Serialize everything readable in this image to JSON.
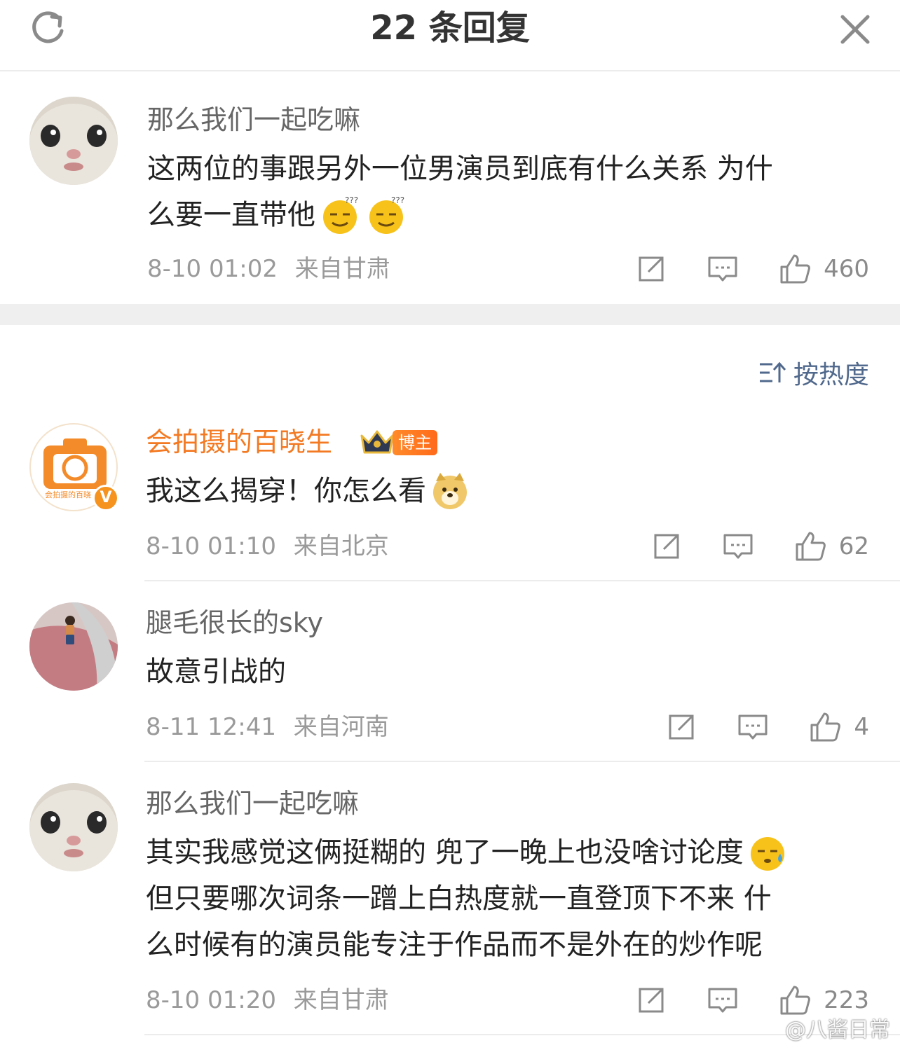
{
  "header": {
    "title": "22 条回复",
    "refresh_icon": "refresh-icon",
    "close_icon": "close-icon"
  },
  "root_comment": {
    "username": "那么我们一起吃嘛",
    "text_line1": "这两位的事跟另外一位男演员到底有什么关系 为什",
    "text_line2": "么要一直带他",
    "time": "8-10 01:02",
    "location": "来自甘肃",
    "likes": "460"
  },
  "sort": {
    "label": "按热度"
  },
  "replies": [
    {
      "username": "会拍摄的百晓生",
      "badge": "博主",
      "avatar_text": "会拍摄的百晓",
      "verified": "V",
      "text": "我这么揭穿！你怎么看",
      "time": "8-10 01:10",
      "location": "来自北京",
      "likes": "62"
    },
    {
      "username": "腿毛很长的sky",
      "text": "故意引战的",
      "time": "8-11 12:41",
      "location": "来自河南",
      "likes": "4"
    },
    {
      "username": "那么我们一起吃嘛",
      "text_line1": "其实我感觉这俩挺糊的 兜了一晚上也没啥讨论度",
      "text_line2": "但只要哪次词条一蹭上白热度就一直登顶下不来 什",
      "text_line3": "么时候有的演员能专注于作品而不是外在的炒作呢",
      "time": "8-10 01:20",
      "location": "来自甘肃",
      "likes": "223"
    }
  ],
  "watermark": "@八酱日常",
  "colors": {
    "orange_username": "#f37a23",
    "sort_blue": "#51698c",
    "meta_gray": "#9a9a9a"
  }
}
